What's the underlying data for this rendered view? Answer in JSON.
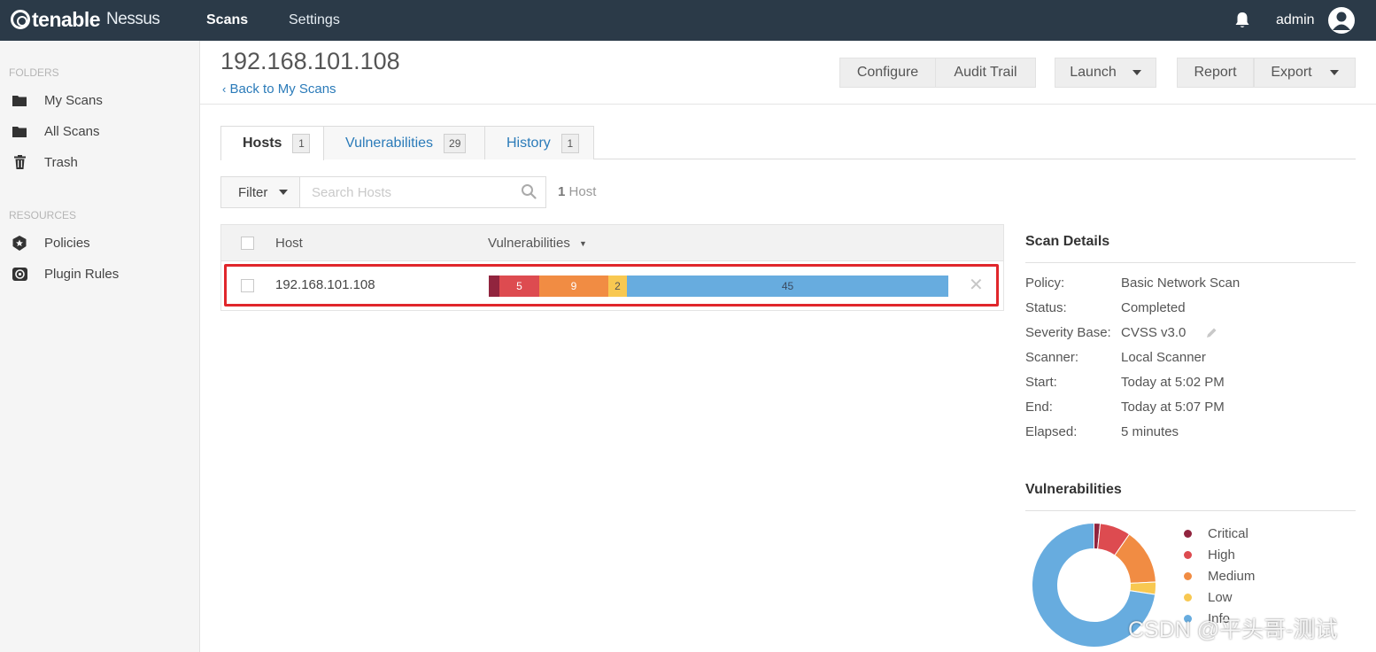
{
  "topbar": {
    "logo_main": "tenable",
    "logo_product": "Nessus",
    "nav_scans": "Scans",
    "nav_settings": "Settings",
    "user": "admin",
    "color": "#2b3a48"
  },
  "sidebar": {
    "folders_heading": "FOLDERS",
    "folders": [
      {
        "label": "My Scans",
        "icon": "folder-icon"
      },
      {
        "label": "All Scans",
        "icon": "folder-icon"
      },
      {
        "label": "Trash",
        "icon": "trash-icon"
      }
    ],
    "resources_heading": "RESOURCES",
    "resources": [
      {
        "label": "Policies",
        "icon": "policy-badge-icon"
      },
      {
        "label": "Plugin Rules",
        "icon": "plugin-rules-icon"
      }
    ]
  },
  "header": {
    "title": "192.168.101.108",
    "back_link": "Back to My Scans",
    "buttons": {
      "configure": "Configure",
      "audit_trail": "Audit Trail",
      "launch": "Launch",
      "report": "Report",
      "export": "Export"
    }
  },
  "tabs": [
    {
      "label": "Hosts",
      "count": "1",
      "active": true
    },
    {
      "label": "Vulnerabilities",
      "count": "29",
      "active": false
    },
    {
      "label": "History",
      "count": "1",
      "active": false
    }
  ],
  "filter": {
    "button": "Filter",
    "placeholder": "Search Hosts",
    "result_count": "1",
    "result_label": "Host"
  },
  "table": {
    "columns": {
      "host": "Host",
      "vulnerabilities": "Vulnerabilities"
    },
    "rows": [
      {
        "host": "192.168.101.108",
        "severity_counts": {
          "critical": "",
          "high": "5",
          "medium": "9",
          "low": "2",
          "info": "45"
        }
      }
    ]
  },
  "severity_colors": {
    "critical": "#91243e",
    "high": "#dd4b50",
    "medium": "#f18c43",
    "low": "#f8c851",
    "info": "#67acdf"
  },
  "scan_details": {
    "title": "Scan Details",
    "rows": [
      {
        "label": "Policy:",
        "value": "Basic Network Scan"
      },
      {
        "label": "Status:",
        "value": "Completed"
      },
      {
        "label": "Severity Base:",
        "value": "CVSS v3.0"
      },
      {
        "label": "Scanner:",
        "value": "Local Scanner"
      },
      {
        "label": "Start:",
        "value": "Today at 5:02 PM"
      },
      {
        "label": "End:",
        "value": "Today at 5:07 PM"
      },
      {
        "label": "Elapsed:",
        "value": "5 minutes"
      }
    ]
  },
  "vulnerabilities_panel": {
    "title": "Vulnerabilities",
    "legend": [
      "Critical",
      "High",
      "Medium",
      "Low",
      "Info"
    ]
  },
  "watermark": "CSDN @平头哥-测试"
}
